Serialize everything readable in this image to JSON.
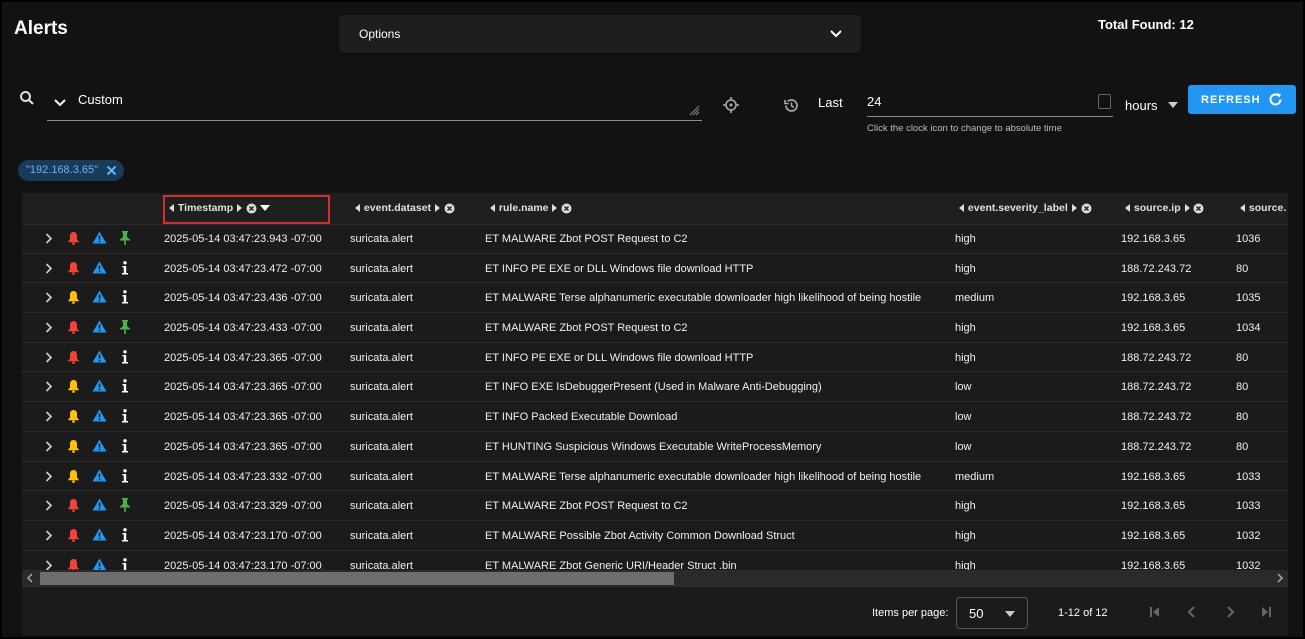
{
  "header": {
    "title": "Alerts",
    "options_label": "Options",
    "total_found": "Total Found: 12"
  },
  "query": {
    "mode": "Custom"
  },
  "time": {
    "last_label": "Last",
    "value": "24",
    "unit": "hours",
    "hint": "Click the clock icon to change to absolute time",
    "refresh_label": "REFRESH"
  },
  "filter_chip": {
    "label": "\"192.168.3.65\""
  },
  "columns": [
    "Timestamp",
    "event.dataset",
    "rule.name",
    "event.severity_label",
    "source.ip",
    "source."
  ],
  "rows": [
    {
      "ts": "2025-05-14 03:47:23.943 -07:00",
      "dataset": "suricata.alert",
      "rule": "ET MALWARE Zbot POST Request to C2",
      "sev": "high",
      "ip": "192.168.3.65",
      "port": "1036",
      "bell": "red",
      "tag": "pin"
    },
    {
      "ts": "2025-05-14 03:47:23.472 -07:00",
      "dataset": "suricata.alert",
      "rule": "ET INFO PE EXE or DLL Windows file download HTTP",
      "sev": "high",
      "ip": "188.72.243.72",
      "port": "80",
      "bell": "red",
      "tag": "info"
    },
    {
      "ts": "2025-05-14 03:47:23.436 -07:00",
      "dataset": "suricata.alert",
      "rule": "ET MALWARE Terse alphanumeric executable downloader high likelihood of being hostile",
      "sev": "medium",
      "ip": "192.168.3.65",
      "port": "1035",
      "bell": "yellow",
      "tag": "info"
    },
    {
      "ts": "2025-05-14 03:47:23.433 -07:00",
      "dataset": "suricata.alert",
      "rule": "ET MALWARE Zbot POST Request to C2",
      "sev": "high",
      "ip": "192.168.3.65",
      "port": "1034",
      "bell": "red",
      "tag": "pin"
    },
    {
      "ts": "2025-05-14 03:47:23.365 -07:00",
      "dataset": "suricata.alert",
      "rule": "ET INFO PE EXE or DLL Windows file download HTTP",
      "sev": "high",
      "ip": "188.72.243.72",
      "port": "80",
      "bell": "red",
      "tag": "info"
    },
    {
      "ts": "2025-05-14 03:47:23.365 -07:00",
      "dataset": "suricata.alert",
      "rule": "ET INFO EXE IsDebuggerPresent (Used in Malware Anti-Debugging)",
      "sev": "low",
      "ip": "188.72.243.72",
      "port": "80",
      "bell": "yellow",
      "tag": "info"
    },
    {
      "ts": "2025-05-14 03:47:23.365 -07:00",
      "dataset": "suricata.alert",
      "rule": "ET INFO Packed Executable Download",
      "sev": "low",
      "ip": "188.72.243.72",
      "port": "80",
      "bell": "yellow",
      "tag": "info"
    },
    {
      "ts": "2025-05-14 03:47:23.365 -07:00",
      "dataset": "suricata.alert",
      "rule": "ET HUNTING Suspicious Windows Executable WriteProcessMemory",
      "sev": "low",
      "ip": "188.72.243.72",
      "port": "80",
      "bell": "yellow",
      "tag": "info"
    },
    {
      "ts": "2025-05-14 03:47:23.332 -07:00",
      "dataset": "suricata.alert",
      "rule": "ET MALWARE Terse alphanumeric executable downloader high likelihood of being hostile",
      "sev": "medium",
      "ip": "192.168.3.65",
      "port": "1033",
      "bell": "yellow",
      "tag": "info"
    },
    {
      "ts": "2025-05-14 03:47:23.329 -07:00",
      "dataset": "suricata.alert",
      "rule": "ET MALWARE Zbot POST Request to C2",
      "sev": "high",
      "ip": "192.168.3.65",
      "port": "1033",
      "bell": "red",
      "tag": "pin"
    },
    {
      "ts": "2025-05-14 03:47:23.170 -07:00",
      "dataset": "suricata.alert",
      "rule": "ET MALWARE Possible Zbot Activity Common Download Struct",
      "sev": "high",
      "ip": "192.168.3.65",
      "port": "1032",
      "bell": "red",
      "tag": "info"
    },
    {
      "ts": "2025-05-14 03:47:23.170 -07:00",
      "dataset": "suricata.alert",
      "rule": "ET MALWARE Zbot Generic URI/Header Struct .bin",
      "sev": "high",
      "ip": "192.168.3.65",
      "port": "1032",
      "bell": "red",
      "tag": "info"
    }
  ],
  "footer": {
    "items_per_page_label": "Items per page:",
    "items_per_page": "50",
    "range": "1-12 of 12"
  },
  "colors": {
    "accent": "#2196f3",
    "bell_red": "#f44336",
    "bell_yellow": "#ffc107",
    "pin_green": "#4caf50",
    "warn_blue": "#2196f3"
  }
}
